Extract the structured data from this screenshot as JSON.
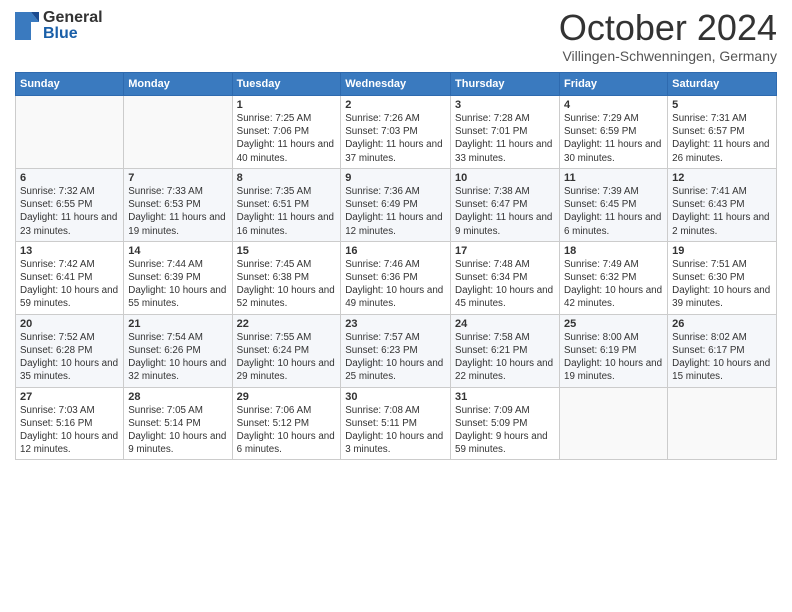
{
  "header": {
    "logo_general": "General",
    "logo_blue": "Blue",
    "month_title": "October 2024",
    "location": "Villingen-Schwenningen, Germany"
  },
  "weekdays": [
    "Sunday",
    "Monday",
    "Tuesday",
    "Wednesday",
    "Thursday",
    "Friday",
    "Saturday"
  ],
  "weeks": [
    [
      {
        "day": "",
        "info": ""
      },
      {
        "day": "",
        "info": ""
      },
      {
        "day": "1",
        "info": "Sunrise: 7:25 AM\nSunset: 7:06 PM\nDaylight: 11 hours and 40 minutes."
      },
      {
        "day": "2",
        "info": "Sunrise: 7:26 AM\nSunset: 7:03 PM\nDaylight: 11 hours and 37 minutes."
      },
      {
        "day": "3",
        "info": "Sunrise: 7:28 AM\nSunset: 7:01 PM\nDaylight: 11 hours and 33 minutes."
      },
      {
        "day": "4",
        "info": "Sunrise: 7:29 AM\nSunset: 6:59 PM\nDaylight: 11 hours and 30 minutes."
      },
      {
        "day": "5",
        "info": "Sunrise: 7:31 AM\nSunset: 6:57 PM\nDaylight: 11 hours and 26 minutes."
      }
    ],
    [
      {
        "day": "6",
        "info": "Sunrise: 7:32 AM\nSunset: 6:55 PM\nDaylight: 11 hours and 23 minutes."
      },
      {
        "day": "7",
        "info": "Sunrise: 7:33 AM\nSunset: 6:53 PM\nDaylight: 11 hours and 19 minutes."
      },
      {
        "day": "8",
        "info": "Sunrise: 7:35 AM\nSunset: 6:51 PM\nDaylight: 11 hours and 16 minutes."
      },
      {
        "day": "9",
        "info": "Sunrise: 7:36 AM\nSunset: 6:49 PM\nDaylight: 11 hours and 12 minutes."
      },
      {
        "day": "10",
        "info": "Sunrise: 7:38 AM\nSunset: 6:47 PM\nDaylight: 11 hours and 9 minutes."
      },
      {
        "day": "11",
        "info": "Sunrise: 7:39 AM\nSunset: 6:45 PM\nDaylight: 11 hours and 6 minutes."
      },
      {
        "day": "12",
        "info": "Sunrise: 7:41 AM\nSunset: 6:43 PM\nDaylight: 11 hours and 2 minutes."
      }
    ],
    [
      {
        "day": "13",
        "info": "Sunrise: 7:42 AM\nSunset: 6:41 PM\nDaylight: 10 hours and 59 minutes."
      },
      {
        "day": "14",
        "info": "Sunrise: 7:44 AM\nSunset: 6:39 PM\nDaylight: 10 hours and 55 minutes."
      },
      {
        "day": "15",
        "info": "Sunrise: 7:45 AM\nSunset: 6:38 PM\nDaylight: 10 hours and 52 minutes."
      },
      {
        "day": "16",
        "info": "Sunrise: 7:46 AM\nSunset: 6:36 PM\nDaylight: 10 hours and 49 minutes."
      },
      {
        "day": "17",
        "info": "Sunrise: 7:48 AM\nSunset: 6:34 PM\nDaylight: 10 hours and 45 minutes."
      },
      {
        "day": "18",
        "info": "Sunrise: 7:49 AM\nSunset: 6:32 PM\nDaylight: 10 hours and 42 minutes."
      },
      {
        "day": "19",
        "info": "Sunrise: 7:51 AM\nSunset: 6:30 PM\nDaylight: 10 hours and 39 minutes."
      }
    ],
    [
      {
        "day": "20",
        "info": "Sunrise: 7:52 AM\nSunset: 6:28 PM\nDaylight: 10 hours and 35 minutes."
      },
      {
        "day": "21",
        "info": "Sunrise: 7:54 AM\nSunset: 6:26 PM\nDaylight: 10 hours and 32 minutes."
      },
      {
        "day": "22",
        "info": "Sunrise: 7:55 AM\nSunset: 6:24 PM\nDaylight: 10 hours and 29 minutes."
      },
      {
        "day": "23",
        "info": "Sunrise: 7:57 AM\nSunset: 6:23 PM\nDaylight: 10 hours and 25 minutes."
      },
      {
        "day": "24",
        "info": "Sunrise: 7:58 AM\nSunset: 6:21 PM\nDaylight: 10 hours and 22 minutes."
      },
      {
        "day": "25",
        "info": "Sunrise: 8:00 AM\nSunset: 6:19 PM\nDaylight: 10 hours and 19 minutes."
      },
      {
        "day": "26",
        "info": "Sunrise: 8:02 AM\nSunset: 6:17 PM\nDaylight: 10 hours and 15 minutes."
      }
    ],
    [
      {
        "day": "27",
        "info": "Sunrise: 7:03 AM\nSunset: 5:16 PM\nDaylight: 10 hours and 12 minutes."
      },
      {
        "day": "28",
        "info": "Sunrise: 7:05 AM\nSunset: 5:14 PM\nDaylight: 10 hours and 9 minutes."
      },
      {
        "day": "29",
        "info": "Sunrise: 7:06 AM\nSunset: 5:12 PM\nDaylight: 10 hours and 6 minutes."
      },
      {
        "day": "30",
        "info": "Sunrise: 7:08 AM\nSunset: 5:11 PM\nDaylight: 10 hours and 3 minutes."
      },
      {
        "day": "31",
        "info": "Sunrise: 7:09 AM\nSunset: 5:09 PM\nDaylight: 9 hours and 59 minutes."
      },
      {
        "day": "",
        "info": ""
      },
      {
        "day": "",
        "info": ""
      }
    ]
  ]
}
